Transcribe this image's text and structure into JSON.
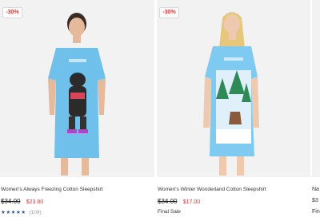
{
  "products": [
    {
      "badge": "-30%",
      "title": "Women's Always Freezing Cotton Sleepshirt",
      "price_old": "$34.00",
      "price_new": "$23.80",
      "rating_stars": "★★★★★",
      "rating_count": "(109)"
    },
    {
      "badge": "-30%",
      "title": "Women's Winter Wonderland Cotton Sleepshirt",
      "price_old": "$34.00",
      "price_new": "$17.00",
      "tag": "Final Sale"
    },
    {
      "title_start": "Na",
      "price_start": "$3",
      "tag_start": "Fin"
    }
  ],
  "colors": {
    "discount": "#e03a3a",
    "star": "#2a58a8",
    "shirt": "#6fc1ec"
  }
}
